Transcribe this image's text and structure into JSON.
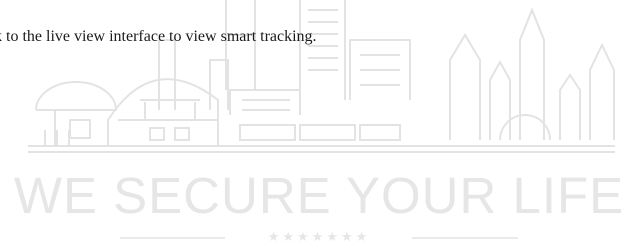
{
  "instruction_text": "k to the live view interface to view smart tracking.",
  "watermark": {
    "slogan": "WE SECURE YOUR LIFE",
    "stars": "★★★★★★★",
    "line_color": "#e3e3e3",
    "text_color": "#e6e6e6",
    "icon": "city-skyline-icon"
  }
}
